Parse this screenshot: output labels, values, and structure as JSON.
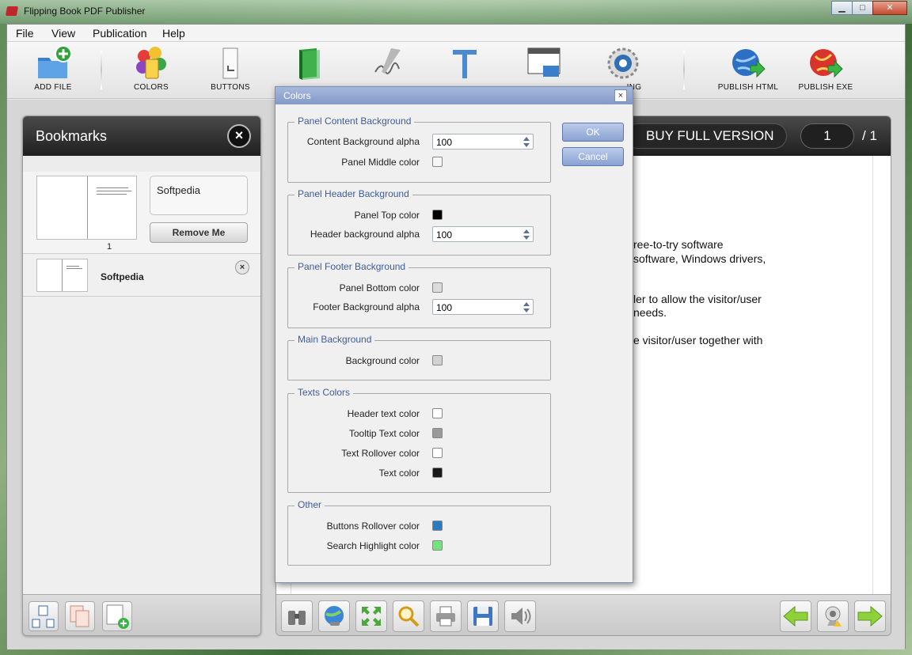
{
  "window": {
    "title": "Flipping Book PDF Publisher",
    "minimize": "▁",
    "maximize": "□",
    "close": "✕"
  },
  "menu": [
    "File",
    "View",
    "Publication",
    "Help"
  ],
  "toolbar": {
    "add_file": "ADD FILE",
    "colors": "COLORS",
    "buttons": "BUTTONS",
    "setting_partial": "ING",
    "publish_html": "PUBLISH HTML",
    "publish_exe": "PUBLISH EXE"
  },
  "bookmarks": {
    "title": "Bookmarks",
    "close": "×",
    "entry_name": "Softpedia",
    "remove_label": "Remove Me",
    "page_number": "1",
    "item2_name": "Softpedia",
    "item2_close": "×"
  },
  "viewer": {
    "buy_label": "BUY FULL VERSION",
    "current_page": "1",
    "total_pages": "/ 1",
    "doc_lines": [
      "ree-to-try software",
      "software, Windows drivers,",
      "ler to allow the visitor/user",
      "needs.",
      "e visitor/user together with"
    ]
  },
  "dialog": {
    "title": "Colors",
    "close": "×",
    "ok_label": "OK",
    "cancel_label": "Cancel",
    "groups": {
      "content": {
        "title": "Panel Content Background",
        "alpha_label": "Content Background alpha",
        "alpha_value": "100",
        "middle_label": "Panel Middle color",
        "middle_color": "#f6f6f6"
      },
      "header": {
        "title": "Panel Header Background",
        "top_label": "Panel Top color",
        "top_color": "#000000",
        "alpha_label": "Header background alpha",
        "alpha_value": "100"
      },
      "footer": {
        "title": "Panel Footer Background",
        "bottom_label": "Panel Bottom color",
        "bottom_color": "#dcdcdc",
        "alpha_label": "Footer Background alpha",
        "alpha_value": "100"
      },
      "main": {
        "title": "Main Background",
        "bg_label": "Background color",
        "bg_color": "#d2d2d2"
      },
      "texts": {
        "title": "Texts Colors",
        "header_label": "Header text color",
        "header_color": "#ffffff",
        "tooltip_label": "Tooltip Text color",
        "tooltip_color": "#9a9a9a",
        "rollover_label": "Text Rollover color",
        "rollover_color": "#ffffff",
        "text_label": "Text color",
        "text_color": "#1a1a1a"
      },
      "other": {
        "title": "Other",
        "btn_rollover_label": "Buttons Rollover color",
        "btn_rollover_color": "#2a7ac4",
        "search_label": "Search Highlight color",
        "search_color": "#6ee67a"
      }
    }
  }
}
